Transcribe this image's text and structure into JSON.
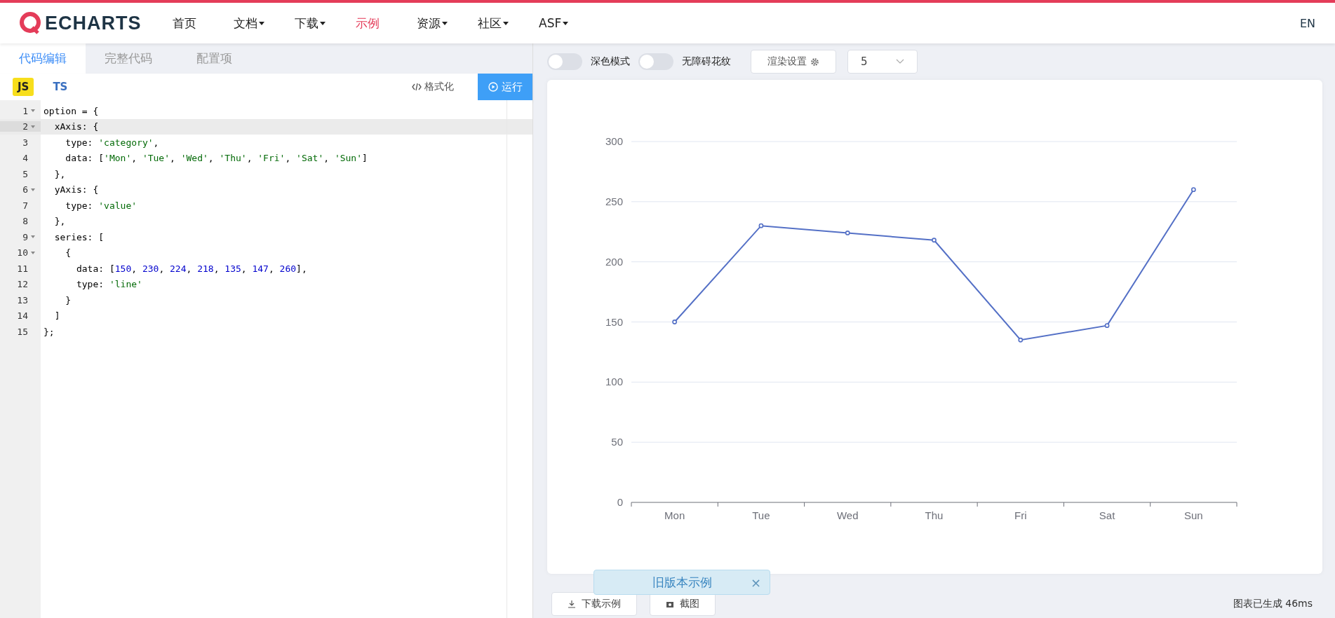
{
  "nav": {
    "logo": "ECHARTS",
    "items": [
      {
        "label": "首页",
        "dropdown": false,
        "selected": false
      },
      {
        "label": "文档",
        "dropdown": true,
        "selected": false
      },
      {
        "label": "下载",
        "dropdown": true,
        "selected": false
      },
      {
        "label": "示例",
        "dropdown": false,
        "selected": true
      },
      {
        "label": "资源",
        "dropdown": true,
        "selected": false
      },
      {
        "label": "社区",
        "dropdown": true,
        "selected": false
      },
      {
        "label": "ASF",
        "dropdown": true,
        "selected": false
      }
    ],
    "language": "EN"
  },
  "editor": {
    "tabs": [
      {
        "label": "代码编辑",
        "selected": true
      },
      {
        "label": "完整代码",
        "selected": false
      },
      {
        "label": "配置项",
        "selected": false
      }
    ],
    "languages": [
      {
        "label": "JS",
        "selected": true
      },
      {
        "label": "TS",
        "selected": false
      }
    ],
    "format_button": "格式化",
    "run_button": "运行",
    "lines": [
      {
        "number": "1",
        "fold": true,
        "current": false,
        "tokens": [
          {
            "kind": "plain",
            "text": "option = {"
          }
        ]
      },
      {
        "number": "2",
        "fold": true,
        "current": true,
        "tokens": [
          {
            "kind": "plain",
            "text": "  xAxis: {"
          }
        ]
      },
      {
        "number": "3",
        "fold": false,
        "current": false,
        "tokens": [
          {
            "kind": "plain",
            "text": "    type: "
          },
          {
            "kind": "string",
            "text": "'category'"
          },
          {
            "kind": "plain",
            "text": ","
          }
        ]
      },
      {
        "number": "4",
        "fold": false,
        "current": false,
        "tokens": [
          {
            "kind": "plain",
            "text": "    data: ["
          },
          {
            "kind": "string",
            "text": "'Mon'"
          },
          {
            "kind": "plain",
            "text": ", "
          },
          {
            "kind": "string",
            "text": "'Tue'"
          },
          {
            "kind": "plain",
            "text": ", "
          },
          {
            "kind": "string",
            "text": "'Wed'"
          },
          {
            "kind": "plain",
            "text": ", "
          },
          {
            "kind": "string",
            "text": "'Thu'"
          },
          {
            "kind": "plain",
            "text": ", "
          },
          {
            "kind": "string",
            "text": "'Fri'"
          },
          {
            "kind": "plain",
            "text": ", "
          },
          {
            "kind": "string",
            "text": "'Sat'"
          },
          {
            "kind": "plain",
            "text": ", "
          },
          {
            "kind": "string",
            "text": "'Sun'"
          },
          {
            "kind": "plain",
            "text": "]"
          }
        ]
      },
      {
        "number": "5",
        "fold": false,
        "current": false,
        "tokens": [
          {
            "kind": "plain",
            "text": "  },"
          }
        ]
      },
      {
        "number": "6",
        "fold": true,
        "current": false,
        "tokens": [
          {
            "kind": "plain",
            "text": "  yAxis: {"
          }
        ]
      },
      {
        "number": "7",
        "fold": false,
        "current": false,
        "tokens": [
          {
            "kind": "plain",
            "text": "    type: "
          },
          {
            "kind": "string",
            "text": "'value'"
          }
        ]
      },
      {
        "number": "8",
        "fold": false,
        "current": false,
        "tokens": [
          {
            "kind": "plain",
            "text": "  },"
          }
        ]
      },
      {
        "number": "9",
        "fold": true,
        "current": false,
        "tokens": [
          {
            "kind": "plain",
            "text": "  series: ["
          }
        ]
      },
      {
        "number": "10",
        "fold": true,
        "current": false,
        "tokens": [
          {
            "kind": "plain",
            "text": "    {"
          }
        ]
      },
      {
        "number": "11",
        "fold": false,
        "current": false,
        "tokens": [
          {
            "kind": "plain",
            "text": "      data: ["
          },
          {
            "kind": "number",
            "text": "150"
          },
          {
            "kind": "plain",
            "text": ", "
          },
          {
            "kind": "number",
            "text": "230"
          },
          {
            "kind": "plain",
            "text": ", "
          },
          {
            "kind": "number",
            "text": "224"
          },
          {
            "kind": "plain",
            "text": ", "
          },
          {
            "kind": "number",
            "text": "218"
          },
          {
            "kind": "plain",
            "text": ", "
          },
          {
            "kind": "number",
            "text": "135"
          },
          {
            "kind": "plain",
            "text": ", "
          },
          {
            "kind": "number",
            "text": "147"
          },
          {
            "kind": "plain",
            "text": ", "
          },
          {
            "kind": "number",
            "text": "260"
          },
          {
            "kind": "plain",
            "text": "],"
          }
        ]
      },
      {
        "number": "12",
        "fold": false,
        "current": false,
        "tokens": [
          {
            "kind": "plain",
            "text": "      type: "
          },
          {
            "kind": "string",
            "text": "'line'"
          }
        ]
      },
      {
        "number": "13",
        "fold": false,
        "current": false,
        "tokens": [
          {
            "kind": "plain",
            "text": "    }"
          }
        ]
      },
      {
        "number": "14",
        "fold": false,
        "current": false,
        "tokens": [
          {
            "kind": "plain",
            "text": "  ]"
          }
        ]
      },
      {
        "number": "15",
        "fold": false,
        "current": false,
        "tokens": [
          {
            "kind": "plain",
            "text": "};"
          }
        ]
      }
    ]
  },
  "preview": {
    "toggles": [
      {
        "label": "深色模式",
        "on": false
      },
      {
        "label": "无障碍花纹",
        "on": false
      }
    ],
    "render_button": "渲染设置",
    "select": {
      "value": "5"
    },
    "chart_data": {
      "type": "line",
      "categories": [
        "Mon",
        "Tue",
        "Wed",
        "Thu",
        "Fri",
        "Sat",
        "Sun"
      ],
      "series": [
        {
          "color": "#5470c6",
          "marker": "circle",
          "values": [
            150,
            230,
            224,
            218,
            135,
            147,
            260
          ]
        }
      ],
      "grid": true,
      "ylim": [
        0,
        300
      ],
      "yticks": [
        0,
        50,
        100,
        150,
        200,
        250,
        300
      ]
    },
    "buttons": [
      "下载示例",
      "截图"
    ],
    "status": "图表已生成 46ms",
    "toast": {
      "text": "旧版本示例",
      "close": "×"
    }
  }
}
